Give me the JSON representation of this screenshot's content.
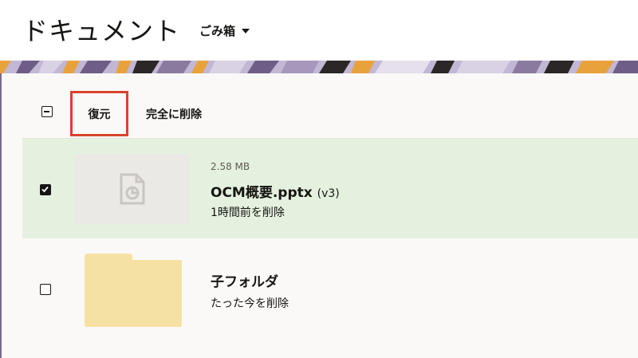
{
  "header": {
    "title": "ドキュメント",
    "folder_selector": "ごみ箱"
  },
  "toolbar": {
    "restore_label": "復元",
    "delete_permanently_label": "完全に削除"
  },
  "items": [
    {
      "size": "2.58 MB",
      "name": "OCM概要.pptx",
      "version": "(v3)",
      "deleted": "1時間前を削除",
      "selected": true,
      "icon": "presentation-file-icon"
    },
    {
      "name": "子フォルダ",
      "deleted": "たった今を削除",
      "selected": false,
      "icon": "folder-icon"
    }
  ],
  "colors": {
    "selected_row": "#e5f1df",
    "restore_highlight": "#d8442b",
    "folder": "#f6e1a5"
  }
}
